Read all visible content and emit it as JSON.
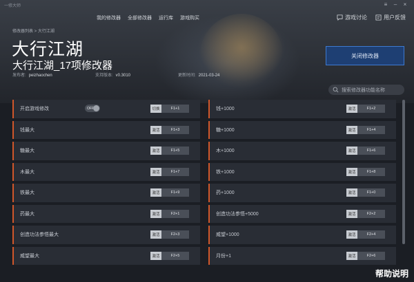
{
  "app": {
    "name": "一修大师"
  },
  "nav": {
    "items": [
      "我的修改器",
      "全部修改器",
      "运行库",
      "游戏购买"
    ]
  },
  "topright": {
    "forum": "游戏讨论",
    "feedback": "用户反馈"
  },
  "breadcrumb": "修改器列表 > 大行江湖",
  "game": {
    "title": "大行江湖",
    "subtitle": "大行江湖_17项修改器"
  },
  "meta": {
    "publisher_label": "发布者:",
    "publisher": "peizhaochen",
    "version_label": "支持版本:",
    "version": "v0.3010",
    "updated_label": "更新时间:",
    "updated": "2021-03-24"
  },
  "close_button": "关闭修改器",
  "search": {
    "placeholder": "搜索修改器功能名称"
  },
  "items": [
    {
      "label": "开启游戏修改",
      "action": "切换",
      "key": "F1+1",
      "toggle": "OFF"
    },
    {
      "label": "钱+1000",
      "action": "激活",
      "key": "F1+2"
    },
    {
      "label": "钱最大",
      "action": "激活",
      "key": "F1+3"
    },
    {
      "label": "糖+1000",
      "action": "激活",
      "key": "F1+4"
    },
    {
      "label": "糖最大",
      "action": "激活",
      "key": "F1+5"
    },
    {
      "label": "木+1000",
      "action": "激活",
      "key": "F1+6"
    },
    {
      "label": "木最大",
      "action": "激活",
      "key": "F1+7"
    },
    {
      "label": "铁+1000",
      "action": "激活",
      "key": "F1+8"
    },
    {
      "label": "铁最大",
      "action": "激活",
      "key": "F1+9"
    },
    {
      "label": "药+1000",
      "action": "激活",
      "key": "F1+0"
    },
    {
      "label": "药最大",
      "action": "激活",
      "key": "F2+1"
    },
    {
      "label": "创造功法参悟+5000",
      "action": "激活",
      "key": "F2+2"
    },
    {
      "label": "创造功法参悟最大",
      "action": "激活",
      "key": "F2+3"
    },
    {
      "label": "威望+1000",
      "action": "激活",
      "key": "F2+4"
    },
    {
      "label": "威望最大",
      "action": "激活",
      "key": "F2+5"
    },
    {
      "label": "月份+1",
      "action": "激活",
      "key": "F2+6"
    }
  ],
  "footer": "帮助说明",
  "colors": {
    "accent": "#d2572a",
    "button_blue": "#1e3f73"
  }
}
